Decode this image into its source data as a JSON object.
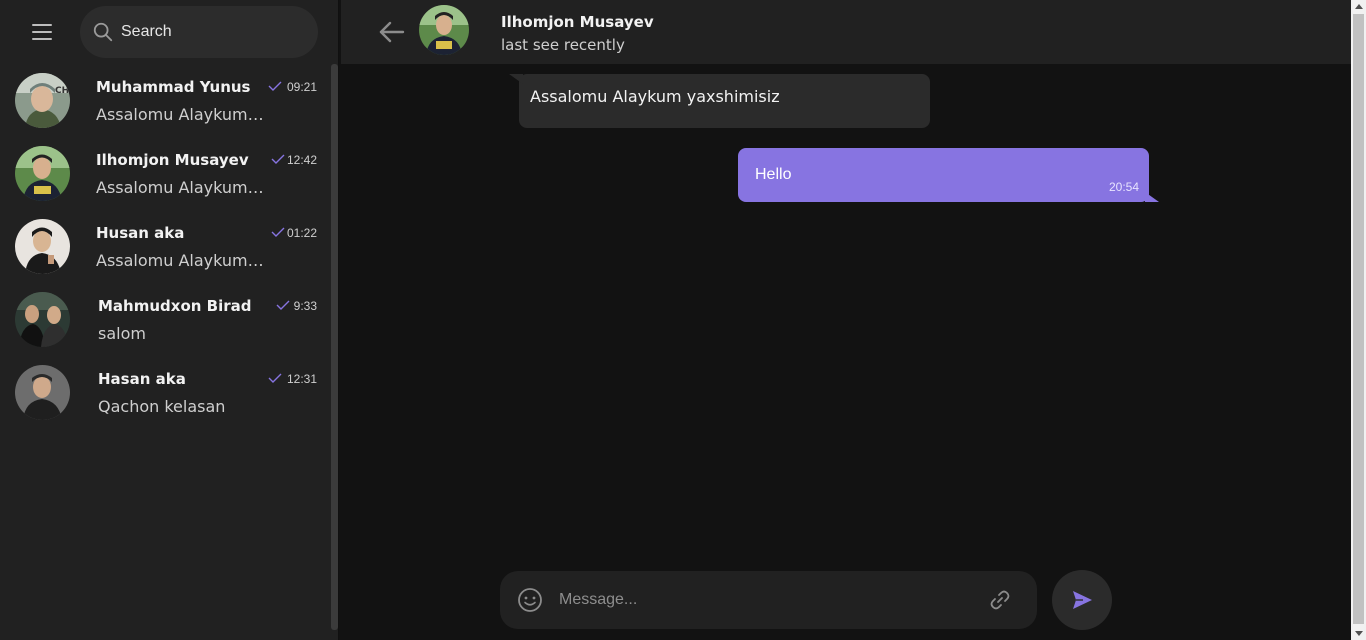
{
  "sidebar": {
    "search_placeholder": "Search",
    "chats": [
      {
        "name": "Muhammad Yunus",
        "preview": "Assalomu Alaykum yaxshimisiz",
        "time": "09:21",
        "avatar_icon": "person-avatar-icon"
      },
      {
        "name": "Ilhomjon Musayev",
        "preview": "Assalomu Alaykum yaxshimisiz",
        "time": "12:42",
        "avatar_icon": "person-avatar-icon"
      },
      {
        "name": "Husan aka",
        "preview": "Assalomu Alaykum yaxshimisiz",
        "time": "01:22",
        "avatar_icon": "person-avatar-icon"
      },
      {
        "name": "Mahmudxon Birad",
        "preview": "salom",
        "time": "9:33",
        "avatar_icon": "person-avatar-icon"
      },
      {
        "name": "Hasan aka",
        "preview": "Qachon kelasan",
        "time": "12:31",
        "avatar_icon": "person-avatar-icon"
      }
    ]
  },
  "header": {
    "name": "Ilhomjon Musayev",
    "status": "last see recently"
  },
  "messages": [
    {
      "direction": "incoming",
      "text": "Assalomu Alaykum yaxshimisiz"
    },
    {
      "direction": "outgoing",
      "text": "Hello",
      "time": "20:54"
    }
  ],
  "composer": {
    "placeholder": "Message..."
  },
  "colors": {
    "accent": "#8774e1",
    "sidebar_bg": "#212121",
    "chat_bg": "#121212",
    "incoming_bubble": "#2b2b2b"
  }
}
